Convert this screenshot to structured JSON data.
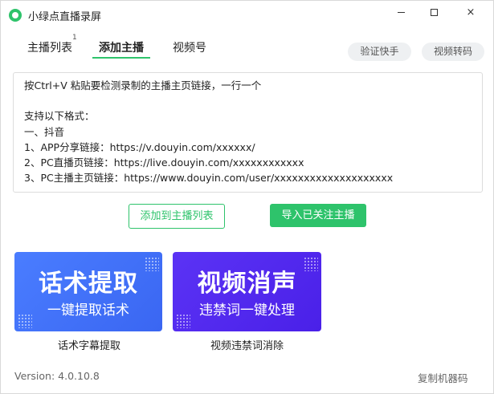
{
  "window": {
    "title": "小绿点直播录屏",
    "controls": {
      "minimize": "minimize-icon",
      "maximize": "maximize-icon",
      "close": "×"
    }
  },
  "tabs": [
    {
      "label": "主播列表",
      "badge": "1"
    },
    {
      "label": "添加主播",
      "active": true
    },
    {
      "label": "视频号"
    }
  ],
  "actions": {
    "verify": "验证快手",
    "transcode": "视频转码"
  },
  "input": {
    "lines": [
      "按Ctrl+V 粘贴要检测录制的主播主页链接，一行一个",
      "",
      "支持以下格式：",
      "一、抖音",
      "1、APP分享链接：https://v.douyin.com/xxxxxx/",
      "2、PC直播页链接：https://live.douyin.com/xxxxxxxxxxxx",
      "3、PC主播主页链接：https://www.douyin.com/user/xxxxxxxxxxxxxxxxxxxx"
    ]
  },
  "buttons": {
    "add_to_list": "添加到主播列表",
    "import_followed": "导入已关注主播"
  },
  "cards": [
    {
      "title": "话术提取",
      "subtitle": "一键提取话术",
      "caption": "话术字幕提取",
      "color": "#4a7dff"
    },
    {
      "title": "视频消声",
      "subtitle": "违禁词一键处理",
      "caption": "视频违禁词消除",
      "color": "#5b33f5"
    }
  ],
  "footer": {
    "version": "Version:  4.0.10.8",
    "copy_code": "复制机器码"
  },
  "colors": {
    "accent": "#2ec36b"
  }
}
